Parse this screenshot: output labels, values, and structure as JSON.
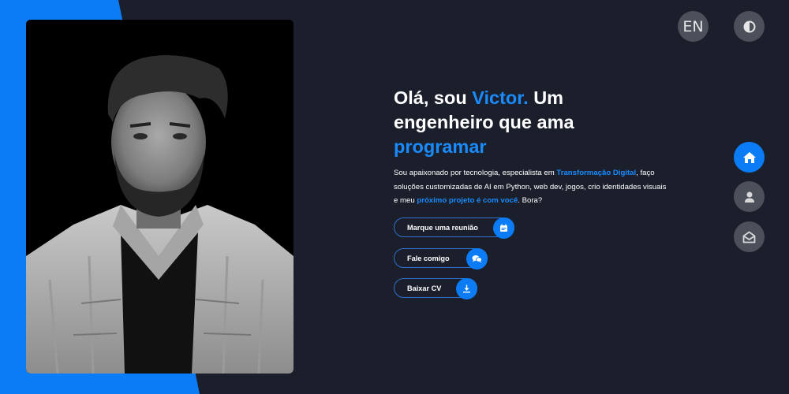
{
  "header": {
    "language_label": "EN",
    "theme_toggle_icon": "half-circle-contrast-icon"
  },
  "sidebar_nav": {
    "items": [
      {
        "name": "home",
        "icon": "home-icon",
        "active": true
      },
      {
        "name": "about",
        "icon": "user-icon",
        "active": false
      },
      {
        "name": "contact",
        "icon": "envelope-open-icon",
        "active": false
      }
    ]
  },
  "hero": {
    "title_part1": "Olá, sou ",
    "title_name": "Victor.",
    "title_part2": " Um engenheiro que ama",
    "title_highlight": " programar",
    "desc_part1": "Sou apaixonado por tecnologia, especialista em ",
    "desc_highlight1": "Transformação Digital",
    "desc_part2": ", faço soluções customizadas de AI em Python, web dev, jogos, crio identidades visuais e meu ",
    "desc_highlight2": "próximo projeto é com você",
    "desc_part3": ". Bora?"
  },
  "actions": {
    "meeting_label": "Marque uma reunião",
    "talk_label": "Fale comigo",
    "cv_label": "Baixar CV"
  },
  "colors": {
    "background": "#1b1f2b",
    "accent": "#0b7cf6",
    "button_gray": "#4b505b"
  }
}
